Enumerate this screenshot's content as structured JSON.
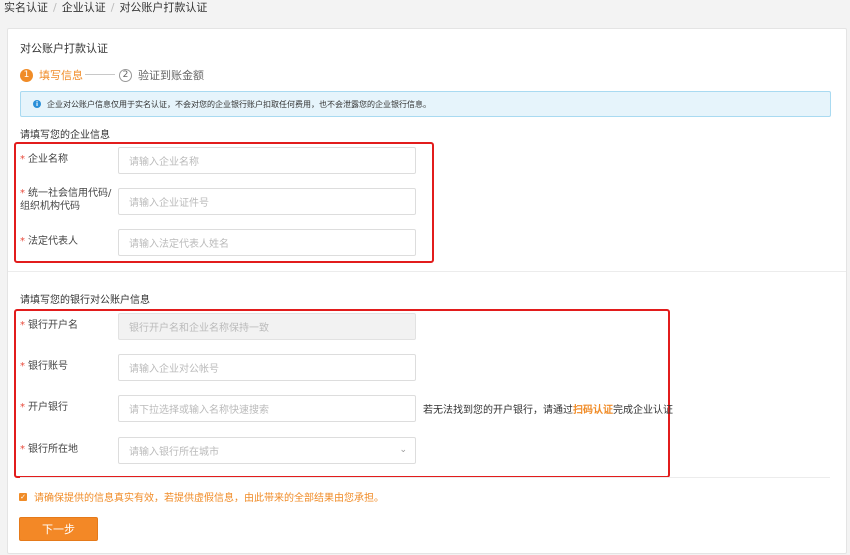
{
  "breadcrumb": {
    "items": [
      "实名认证",
      "企业认证",
      "对公账户打款认证"
    ],
    "separator": "/"
  },
  "card": {
    "title": "对公账户打款认证"
  },
  "steps": [
    {
      "number": "1",
      "label": "填写信息"
    },
    {
      "number": "2",
      "label": "验证到账金额"
    }
  ],
  "notice": {
    "icon": "info-icon",
    "text": "企业对公账户信息仅用于实名认证，不会对您的企业银行账户扣取任何费用，也不会泄露您的企业银行信息。"
  },
  "required_mark": "*",
  "company_section": {
    "title": "请填写您的企业信息",
    "fields": [
      {
        "label": "企业名称",
        "placeholder": "请输入企业名称"
      },
      {
        "label_line1": "统一社会信用代码/",
        "label_line2": "组织机构代码",
        "placeholder": "请输入企业证件号"
      },
      {
        "label": "法定代表人",
        "placeholder": "请输入法定代表人姓名"
      }
    ]
  },
  "bank_section": {
    "title": "请填写您的银行对公账户信息",
    "fields": [
      {
        "label": "银行开户名",
        "placeholder": "银行开户名和企业名称保持一致",
        "disabled": true
      },
      {
        "label": "银行账号",
        "placeholder": "请输入企业对公帐号"
      },
      {
        "label": "开户银行",
        "placeholder": "请下拉选择或输入名称快速搜索"
      },
      {
        "label": "银行所在地",
        "placeholder": "请输入银行所在城市"
      }
    ],
    "hint": {
      "prefix": "若无法找到您的开户银行，请通过",
      "link": "扫码认证",
      "suffix": "完成企业认证"
    },
    "dropdown_icon": "chevron-down-icon"
  },
  "agreement": {
    "checked": true,
    "text": "请确保提供的信息真实有效，若提供虚假信息，由此带来的全部结果由您承担。"
  },
  "next_button": {
    "label": "下一步"
  },
  "colors": {
    "accent": "#f08c28",
    "highlight_border": "#e21c1c",
    "notice_bg": "#e6f4fb",
    "info_blue": "#2a8fd8"
  }
}
